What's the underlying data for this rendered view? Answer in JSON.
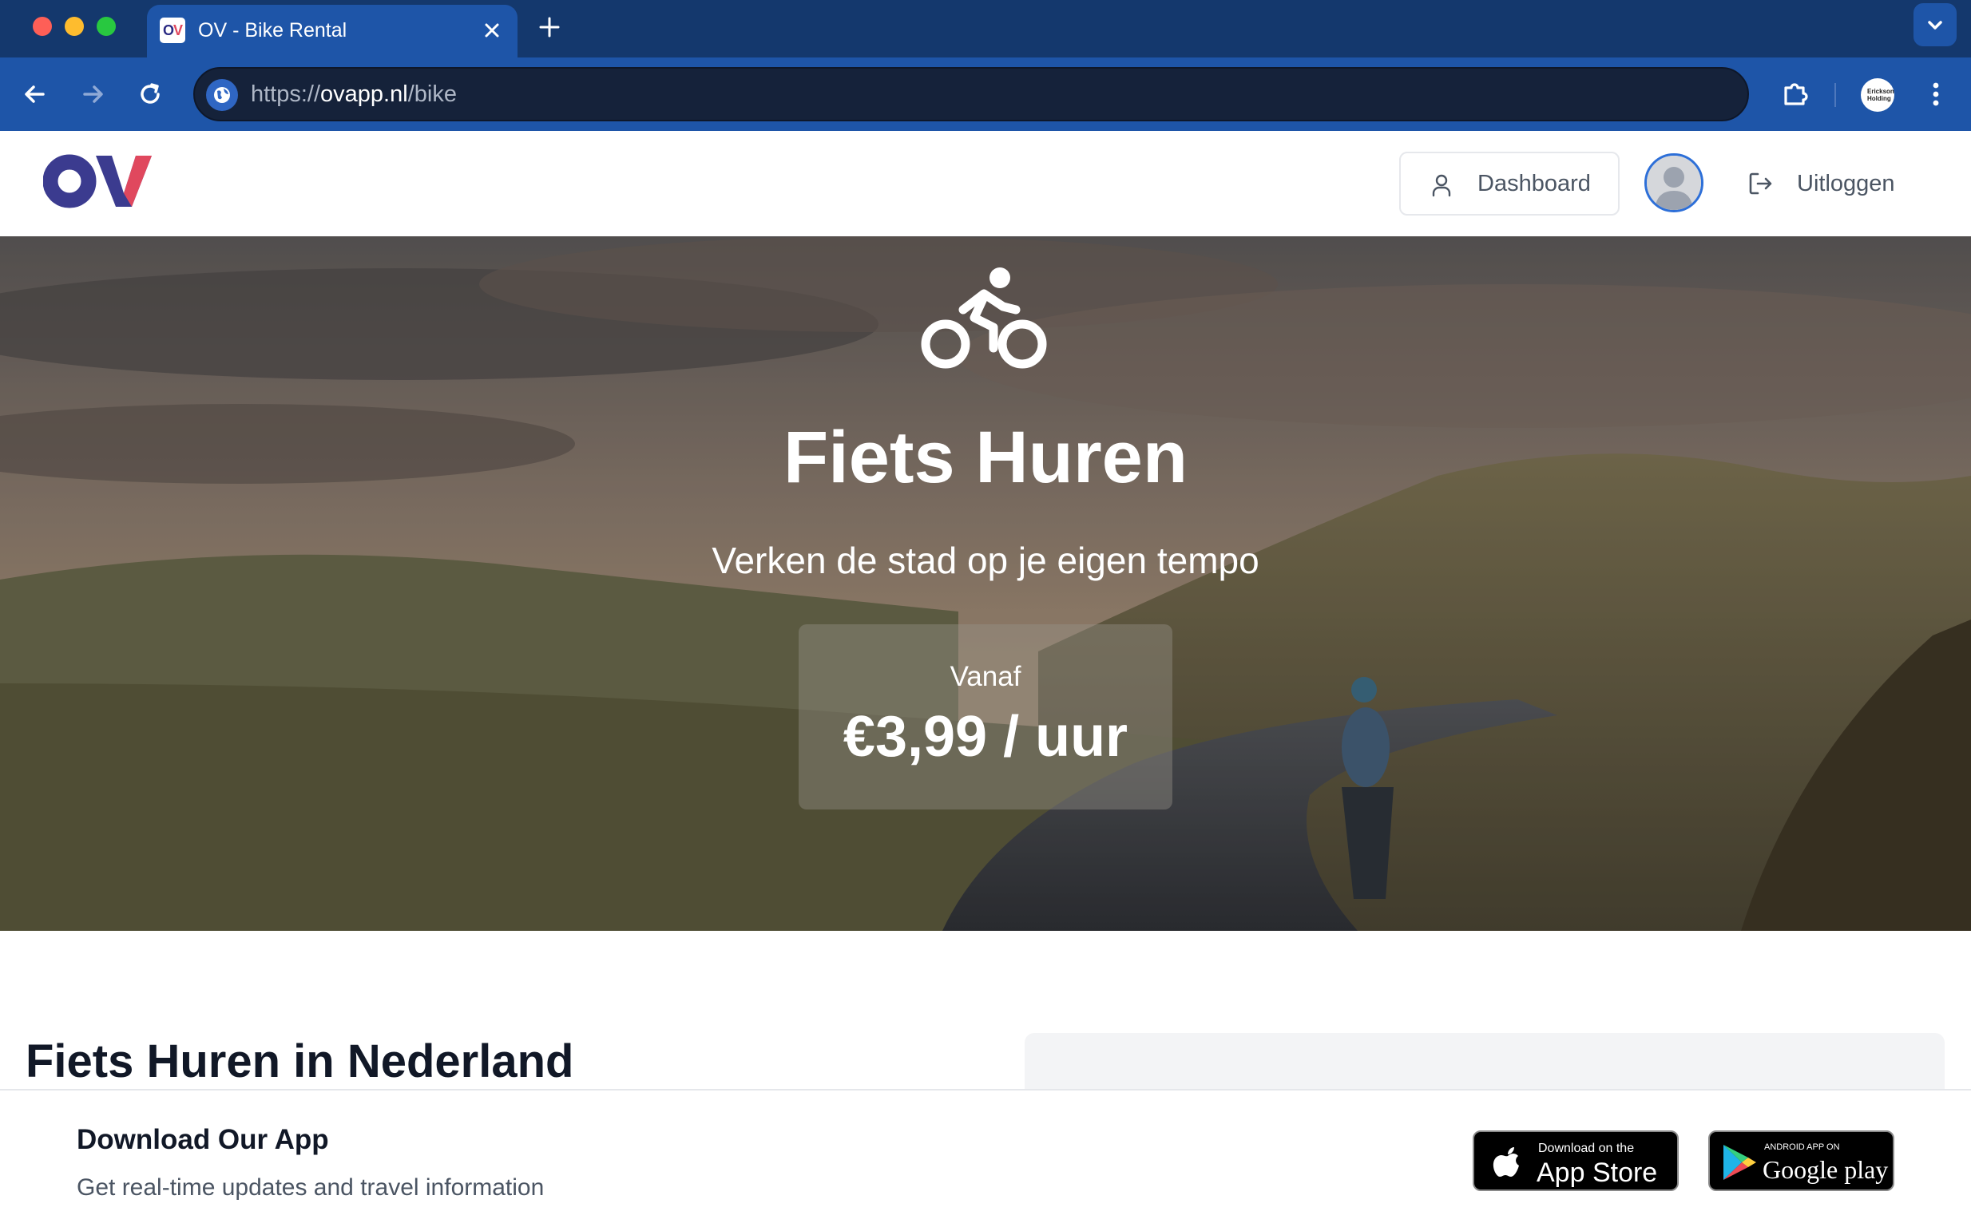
{
  "browser": {
    "tab_title": "OV - Bike Rental",
    "favicon_text": "OV",
    "url_scheme": "https://",
    "url_host": "ovapp.nl",
    "url_path": "/bike",
    "profile_label": "Erickson Holding"
  },
  "header": {
    "logo_text": "OV",
    "dashboard_label": "Dashboard",
    "logout_label": "Uitloggen"
  },
  "hero": {
    "icon": "bicycle-icon",
    "title": "Fiets Huren",
    "subtitle": "Verken de stad op je eigen tempo",
    "price_label": "Vanaf",
    "price_value": "€3,99 / uur"
  },
  "content": {
    "title": "Fiets Huren in Nederland"
  },
  "app_banner": {
    "title": "Download Our App",
    "subtitle": "Get real-time updates and travel information",
    "appstore_small": "Download on the",
    "appstore_big": "App Store",
    "googleplay_small": "ANDROID APP ON",
    "googleplay_big": "Google play"
  },
  "colors": {
    "chrome_dark": "#14386d",
    "chrome": "#1e55a8",
    "omnibox": "#15223a",
    "logo_o": "#3b3b8f",
    "logo_v": "#e0485e",
    "avatar_ring": "#2d6fd8"
  }
}
